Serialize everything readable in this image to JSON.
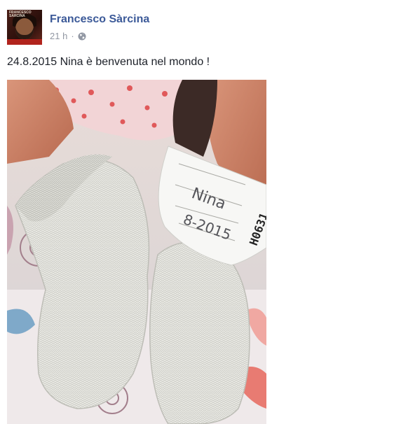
{
  "post": {
    "author": "Francesco Sàrcina",
    "timestamp": "21 h",
    "separator": "·",
    "privacy_icon": "globe-icon",
    "avatar_text": "FRANCESCO SÀRCINA",
    "message": "24.8.2015 Nina è benvenuta nel mondo !",
    "photo": {
      "subject": "baby feet in white knit socks with hospital wristband",
      "wristband_number": "H0631",
      "wristband_handwriting_1": "Nina",
      "wristband_handwriting_2": "8-2015"
    }
  },
  "colors": {
    "link_blue": "#3b5998",
    "meta_gray": "#9197a3",
    "text": "#1d2129"
  }
}
